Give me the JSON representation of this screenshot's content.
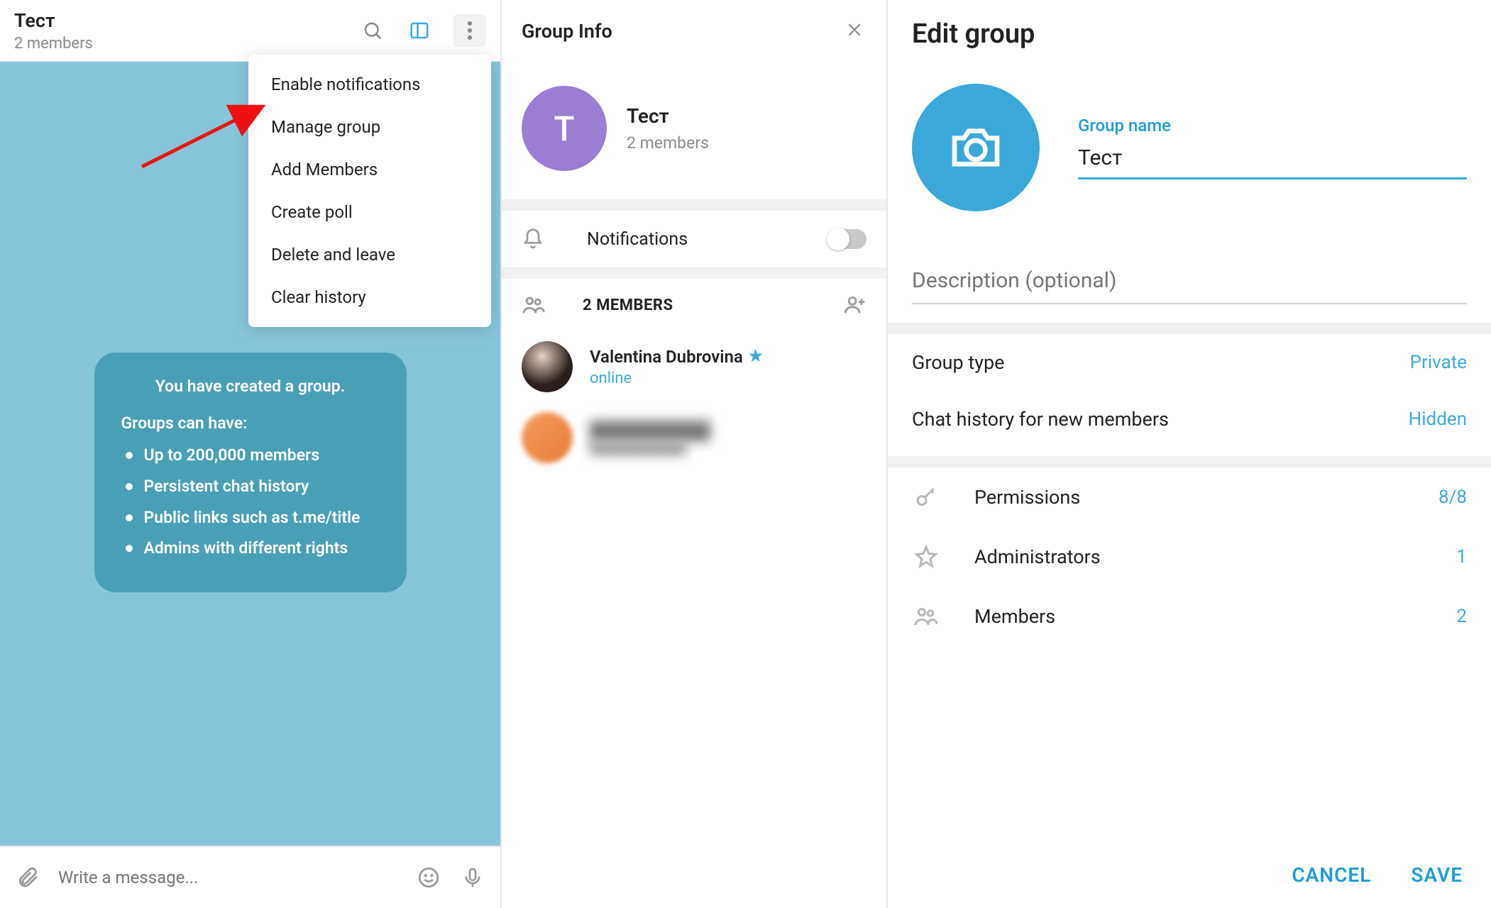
{
  "chat": {
    "title": "Тест",
    "members": "2 members",
    "dropdown": [
      "Enable notifications",
      "Manage group",
      "Add Members",
      "Create poll",
      "Delete and leave",
      "Clear history"
    ],
    "bubble": {
      "title": "You have created a group.",
      "subtitle": "Groups can have:",
      "items": [
        "Up to 200,000 members",
        "Persistent chat history",
        "Public links such as t.me/title",
        "Admins with different rights"
      ]
    },
    "composer_placeholder": "Write a message..."
  },
  "info": {
    "title": "Group Info",
    "name": "Тест",
    "members": "2 members",
    "avatar_letter": "T",
    "notifications_label": "Notifications",
    "members_header": "2 MEMBERS",
    "members_list": [
      {
        "name": "Valentina Dubrovina",
        "status": "online",
        "starred": true
      }
    ]
  },
  "edit": {
    "title": "Edit group",
    "groupname_label": "Group name",
    "groupname_value": "Тест",
    "description_placeholder": "Description (optional)",
    "rows": {
      "group_type": {
        "label": "Group type",
        "value": "Private"
      },
      "chat_history": {
        "label": "Chat history for new members",
        "value": "Hidden"
      },
      "permissions": {
        "label": "Permissions",
        "value": "8/8"
      },
      "administrators": {
        "label": "Administrators",
        "value": "1"
      },
      "members": {
        "label": "Members",
        "value": "2"
      }
    },
    "cancel_label": "CANCEL",
    "save_label": "SAVE"
  }
}
